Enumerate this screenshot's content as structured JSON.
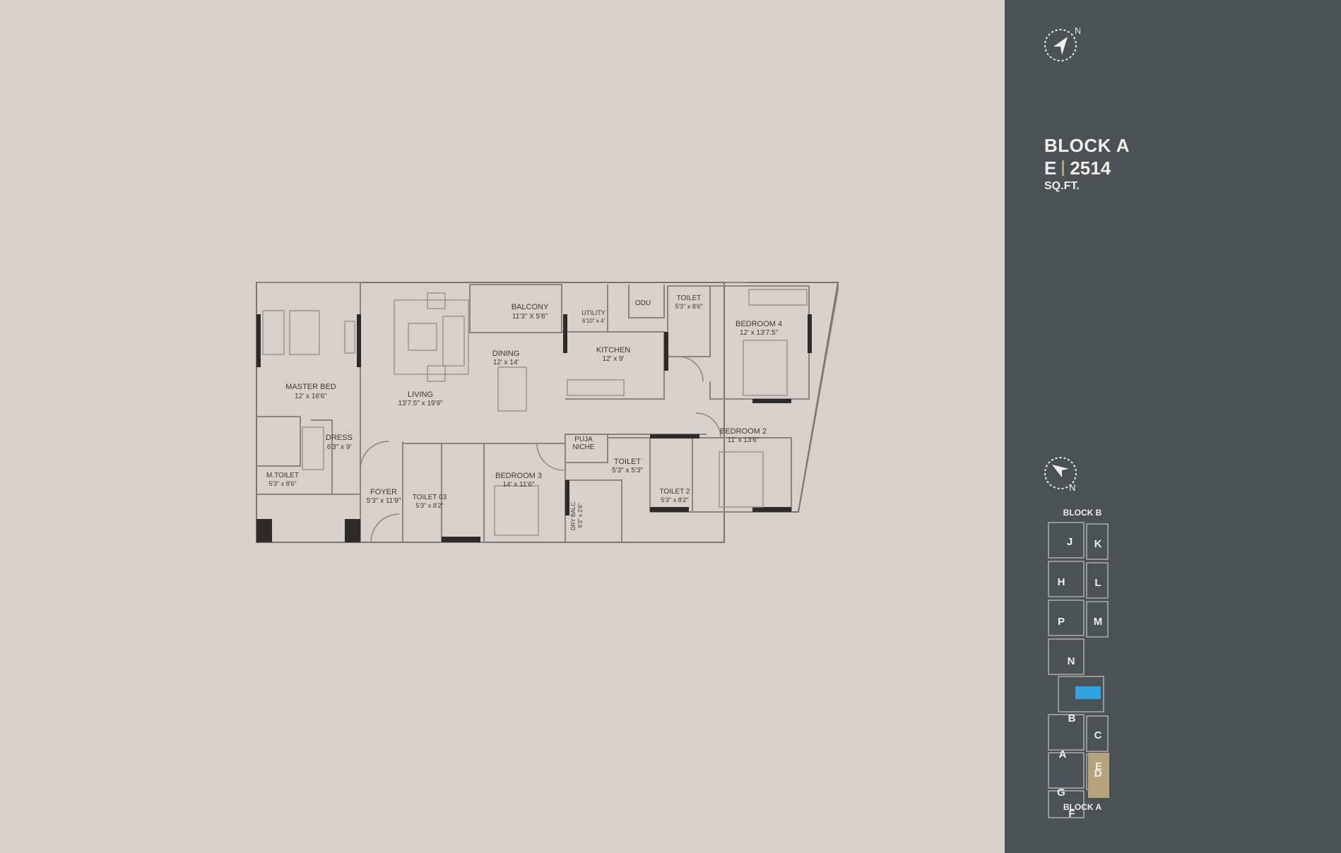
{
  "header": {
    "block": "BLOCK A",
    "unit": "E",
    "area": "2514",
    "unit_label": "SQ.FT."
  },
  "compass": {
    "letter": "N"
  },
  "rooms": {
    "balcony": {
      "name": "BALCONY",
      "size": "11'3\" X 5'6\""
    },
    "utility": {
      "name": "UTILITY",
      "size": "6'10\" x 4'"
    },
    "odu": {
      "name": "ODU"
    },
    "toilet_top": {
      "name": "TOILET",
      "size": "5'3\" x 8'6\""
    },
    "bedroom4": {
      "name": "BEDROOM 4",
      "size": "12' x 13'7.5\""
    },
    "dining": {
      "name": "DINING",
      "size": "12' x 14'"
    },
    "kitchen": {
      "name": "KITCHEN",
      "size": "12' x 9'"
    },
    "master_bed": {
      "name": "MASTER BED",
      "size": "12' x 16'6\""
    },
    "living": {
      "name": "LIVING",
      "size": "13'7.5\" x 19'9\""
    },
    "dress": {
      "name": "DRESS",
      "size": "6'3\" x 9'"
    },
    "bedroom2": {
      "name": "BEDROOM 2",
      "size": "11' x 13'6\""
    },
    "puja": {
      "name": "PUJA",
      "name2": "NICHE"
    },
    "toilet_mid": {
      "name": "TOILET",
      "size": "5'3\" x 5'3\""
    },
    "m_toilet": {
      "name": "M.TOILET",
      "size": "5'3\" x 8'6\""
    },
    "bedroom3": {
      "name": "BEDROOM 3",
      "size": "14' x 11'6\""
    },
    "foyer": {
      "name": "FOYER",
      "size": "5'3\" x 11'9\""
    },
    "toilet03": {
      "name": "TOILET 03",
      "size": "5'3\" x 8'2\""
    },
    "toilet2": {
      "name": "TOILET 2",
      "size": "5'3\" x 8'2\""
    },
    "dry_balc": {
      "name": "DRY BALC.",
      "size": "6'3\" x 2'6\""
    }
  },
  "site_map": {
    "top_label": "BLOCK B",
    "bottom_label": "BLOCK A",
    "units": [
      "J",
      "K",
      "H",
      "L",
      "P",
      "M",
      "N",
      "B",
      "C",
      "A",
      "D",
      "G",
      "E",
      "F"
    ],
    "highlight_unit": "E",
    "highlight_color": "#b5a37a",
    "pool_color": "#2fa3e0"
  },
  "colors": {
    "background": "#d8d0ca",
    "sidebar": "#4b5256",
    "accent": "#b5a37a"
  }
}
